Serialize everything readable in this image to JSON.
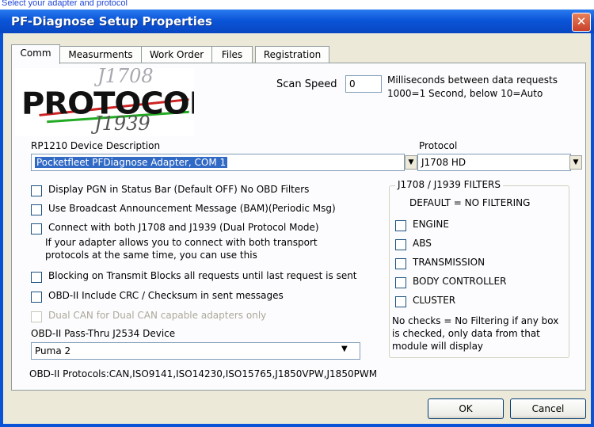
{
  "tip_text": "Select your adapter and protocol",
  "window": {
    "title": "PF-Diagnose Setup Properties",
    "close_glyph": "✕"
  },
  "tabs": [
    {
      "label": "Comm",
      "active": true
    },
    {
      "label": "Measurments",
      "active": false
    },
    {
      "label": "Work Order",
      "active": false
    },
    {
      "label": "Files",
      "active": false
    },
    {
      "label": "Registration",
      "active": false
    }
  ],
  "logo": {
    "main": "PROTOCOL",
    "top": "J1708",
    "bottom": "J1939"
  },
  "scan_speed": {
    "label": "Scan Speed",
    "value": "0",
    "note_line1": "Milliseconds between data requests",
    "note_line2": "1000=1 Second, below 10=Auto"
  },
  "device": {
    "label": "RP1210 Device Description",
    "selected": "Pocketfleet PFDiagnose Adapter, COM 1"
  },
  "protocol": {
    "label": "Protocol",
    "selected": "J1708 HD"
  },
  "options": [
    {
      "label": "Display PGN in Status Bar (Default OFF) No OBD Filters",
      "checked": false,
      "enabled": true
    },
    {
      "label": "Use Broadcast Announcement Message (BAM)(Periodic Msg)",
      "checked": false,
      "enabled": true
    },
    {
      "label": "Connect with both J1708 and J1939 (Dual Protocol Mode)",
      "checked": false,
      "enabled": true
    },
    {
      "label": "Blocking on Transmit  Blocks all requests until last request is sent",
      "checked": false,
      "enabled": true
    },
    {
      "label": "OBD-II Include CRC / Checksum in sent messages",
      "checked": false,
      "enabled": true
    },
    {
      "label": "Dual CAN  for Dual CAN capable adapters only",
      "checked": false,
      "enabled": false
    }
  ],
  "dual_note": {
    "line1": "If your adapter allows you to connect with both transport",
    "line2": "protocols at the same time, you can use this"
  },
  "passthru": {
    "label": "OBD-II Pass-Thru J2534 Device",
    "selected": "Puma 2"
  },
  "obd_protocols": "OBD-II Protocols:CAN,ISO9141,ISO14230,ISO15765,J1850VPW,J1850PWM",
  "filters": {
    "title": "J1708 / J1939 FILTERS",
    "default_text": "DEFAULT = NO FILTERING",
    "items": [
      {
        "label": "ENGINE",
        "checked": false
      },
      {
        "label": "ABS",
        "checked": false
      },
      {
        "label": "TRANSMISSION",
        "checked": false
      },
      {
        "label": "BODY CONTROLLER",
        "checked": false
      },
      {
        "label": "CLUSTER",
        "checked": false
      }
    ],
    "note_line1": "No checks = No Filtering if any box",
    "note_line2": "is checked, only data from that",
    "note_line3": "module will display"
  },
  "buttons": {
    "ok": "OK",
    "cancel": "Cancel"
  },
  "colors": {
    "title_bar": "#0b55d8",
    "dialog_bg": "#ece9d8",
    "selection": "#316ac5"
  }
}
